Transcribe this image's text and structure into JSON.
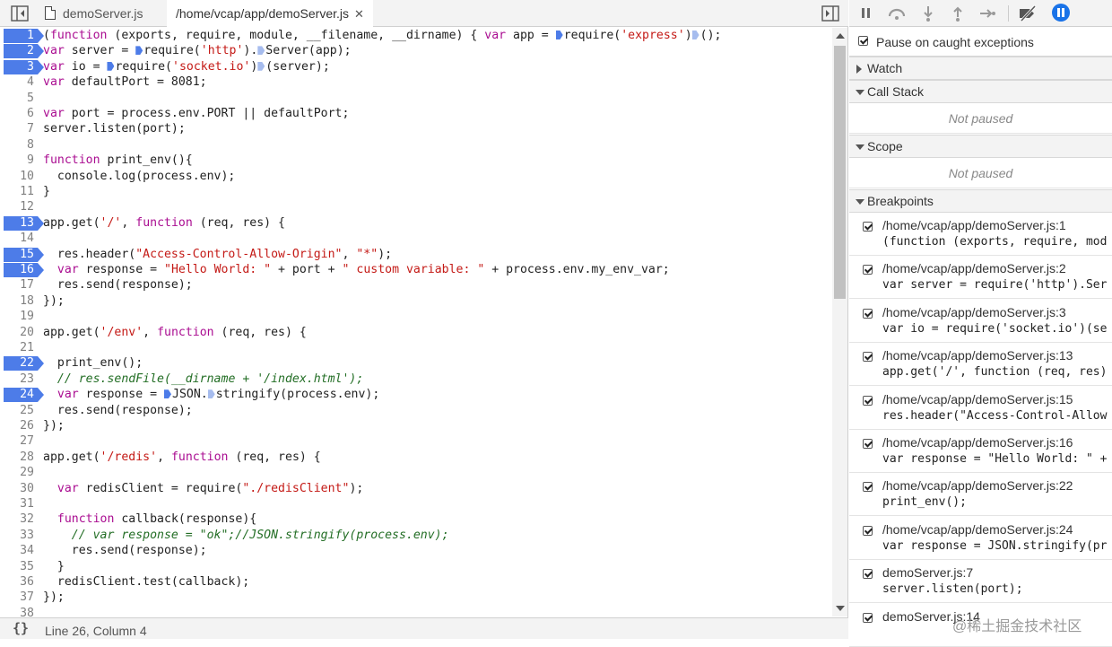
{
  "tabs": [
    {
      "label": "demoServer.js"
    },
    {
      "label": "/home/vcap/app/demoServer.js",
      "close": "✕"
    }
  ],
  "code_lines": [
    {
      "n": "1",
      "bp": true,
      "html": "(<span class=\"kw\">function</span> (exports, require, module, __filename, __dirname) { <span class=\"kw\">var</span> app = <i class=\"mk\"></i>require(<span class=\"str\">'express'</span>)<i class=\"mk light\"></i>();"
    },
    {
      "n": "2",
      "bp": true,
      "html": "<span class=\"kw\">var</span> server = <i class=\"mk\"></i>require(<span class=\"str\">'http'</span>).<i class=\"mk light\"></i>Server(app);"
    },
    {
      "n": "3",
      "bp": true,
      "html": "<span class=\"kw\">var</span> io = <i class=\"mk\"></i>require(<span class=\"str\">'socket.io'</span>)<i class=\"mk light\"></i>(server);"
    },
    {
      "n": "4",
      "bp": false,
      "html": "<span class=\"kw\">var</span> defaultPort = 8081;"
    },
    {
      "n": "5",
      "bp": false,
      "html": ""
    },
    {
      "n": "6",
      "bp": false,
      "html": "<span class=\"kw\">var</span> port = process.env.PORT || defaultPort;"
    },
    {
      "n": "7",
      "bp": false,
      "html": "server.listen(port);"
    },
    {
      "n": "8",
      "bp": false,
      "html": ""
    },
    {
      "n": "9",
      "bp": false,
      "html": "<span class=\"kw\">function</span> print_env(){"
    },
    {
      "n": "10",
      "bp": false,
      "html": "  console.log(process.env);"
    },
    {
      "n": "11",
      "bp": false,
      "html": "}"
    },
    {
      "n": "12",
      "bp": false,
      "html": ""
    },
    {
      "n": "13",
      "bp": true,
      "html": "app.get(<span class=\"str\">'/'</span>, <span class=\"kw\">function</span> (req, res) {"
    },
    {
      "n": "14",
      "bp": false,
      "html": ""
    },
    {
      "n": "15",
      "bp": true,
      "html": "  res.header(<span class=\"str\">\"Access-Control-Allow-Origin\"</span>, <span class=\"str\">\"*\"</span>);"
    },
    {
      "n": "16",
      "bp": true,
      "html": "  <span class=\"kw\">var</span> response = <span class=\"str\">\"Hello World: \"</span> + port + <span class=\"str\">\" custom variable: \"</span> + process.env.my_env_var;"
    },
    {
      "n": "17",
      "bp": false,
      "html": "  res.send(response);"
    },
    {
      "n": "18",
      "bp": false,
      "html": "});"
    },
    {
      "n": "19",
      "bp": false,
      "html": ""
    },
    {
      "n": "20",
      "bp": false,
      "html": "app.get(<span class=\"str\">'/env'</span>, <span class=\"kw\">function</span> (req, res) {"
    },
    {
      "n": "21",
      "bp": false,
      "html": ""
    },
    {
      "n": "22",
      "bp": true,
      "html": "  print_env();"
    },
    {
      "n": "23",
      "bp": false,
      "html": "  <span class=\"cm\">// res.sendFile(__dirname + '/index.html');</span>"
    },
    {
      "n": "24",
      "bp": true,
      "html": "  <span class=\"kw\">var</span> response = <i class=\"mk\"></i>JSON.<i class=\"mk light\"></i>stringify(process.env);"
    },
    {
      "n": "25",
      "bp": false,
      "html": "  res.send(response);"
    },
    {
      "n": "26",
      "bp": false,
      "html": "});"
    },
    {
      "n": "27",
      "bp": false,
      "html": ""
    },
    {
      "n": "28",
      "bp": false,
      "html": "app.get(<span class=\"str\">'/redis'</span>, <span class=\"kw\">function</span> (req, res) {"
    },
    {
      "n": "29",
      "bp": false,
      "html": ""
    },
    {
      "n": "30",
      "bp": false,
      "html": "  <span class=\"kw\">var</span> redisClient = require(<span class=\"str\">\"./redisClient\"</span>);"
    },
    {
      "n": "31",
      "bp": false,
      "html": ""
    },
    {
      "n": "32",
      "bp": false,
      "html": "  <span class=\"kw\">function</span> callback(response){"
    },
    {
      "n": "33",
      "bp": false,
      "html": "    <span class=\"cm\">// var response = \"ok\";//JSON.stringify(process.env);</span>"
    },
    {
      "n": "34",
      "bp": false,
      "html": "    res.send(response);"
    },
    {
      "n": "35",
      "bp": false,
      "html": "  }"
    },
    {
      "n": "36",
      "bp": false,
      "html": "  redisClient.test(callback);"
    },
    {
      "n": "37",
      "bp": false,
      "html": "});"
    },
    {
      "n": "38",
      "bp": false,
      "html": ""
    }
  ],
  "status": {
    "braces": "{}",
    "position": "Line 26, Column 4"
  },
  "panel": {
    "pause_on_exceptions": "Pause on caught exceptions",
    "watch": "Watch",
    "call_stack": "Call Stack",
    "call_stack_empty": "Not paused",
    "scope": "Scope",
    "scope_empty": "Not paused",
    "breakpoints": "Breakpoints"
  },
  "breakpoints": [
    {
      "location": "/home/vcap/app/demoServer.js:1",
      "snippet": "(function (exports, require, mod"
    },
    {
      "location": "/home/vcap/app/demoServer.js:2",
      "snippet": "var server = require('http').Ser"
    },
    {
      "location": "/home/vcap/app/demoServer.js:3",
      "snippet": "var io = require('socket.io')(se"
    },
    {
      "location": "/home/vcap/app/demoServer.js:13",
      "snippet": "app.get('/', function (req, res)"
    },
    {
      "location": "/home/vcap/app/demoServer.js:15",
      "snippet": "res.header(\"Access-Control-Allow"
    },
    {
      "location": "/home/vcap/app/demoServer.js:16",
      "snippet": "var response = \"Hello World: \" +"
    },
    {
      "location": "/home/vcap/app/demoServer.js:22",
      "snippet": "print_env();"
    },
    {
      "location": "/home/vcap/app/demoServer.js:24",
      "snippet": "var response = JSON.stringify(pr"
    },
    {
      "location": "demoServer.js:7",
      "snippet": "server.listen(port);"
    },
    {
      "location": "demoServer.js:14",
      "snippet": ""
    }
  ],
  "watermark": "@稀土掘金技术社区",
  "colors": {
    "breakpoint": "#4d7ce8",
    "keyword": "#aa0d91",
    "string": "#c41a16",
    "comment": "#236e25",
    "pause_exceptions": "#1a73e8"
  }
}
